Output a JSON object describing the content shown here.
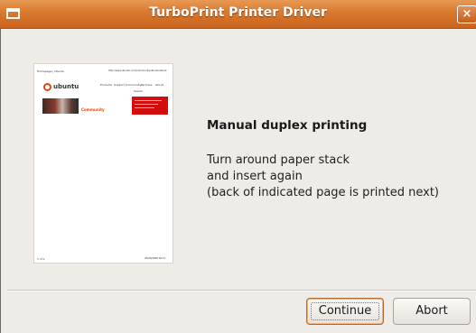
{
  "window": {
    "title": "TurboPrint Printer Driver",
    "close_label": "×"
  },
  "preview": {
    "header_left": "Homepage | Ubuntu",
    "header_right": "http://www.ubuntu.com/community/ubuntu/about",
    "logo_text": "ubuntu",
    "nav_items": [
      "Products",
      "Support",
      "Community",
      "Partners",
      "About"
    ],
    "search_label": "Search",
    "community_label": "Community",
    "footer_left": "1 of 1",
    "footer_right": "20/06/2008 09:12"
  },
  "message": {
    "title": "Manual duplex printing",
    "lines": [
      "Turn around paper stack",
      "and insert again",
      "(back of indicated page is printed next)"
    ]
  },
  "buttons": {
    "continue_label": "Continue",
    "abort_label": "Abort"
  },
  "colors": {
    "titlebar": "#d9782e",
    "window_bg": "#efebe7",
    "accent": "#dd4814"
  }
}
